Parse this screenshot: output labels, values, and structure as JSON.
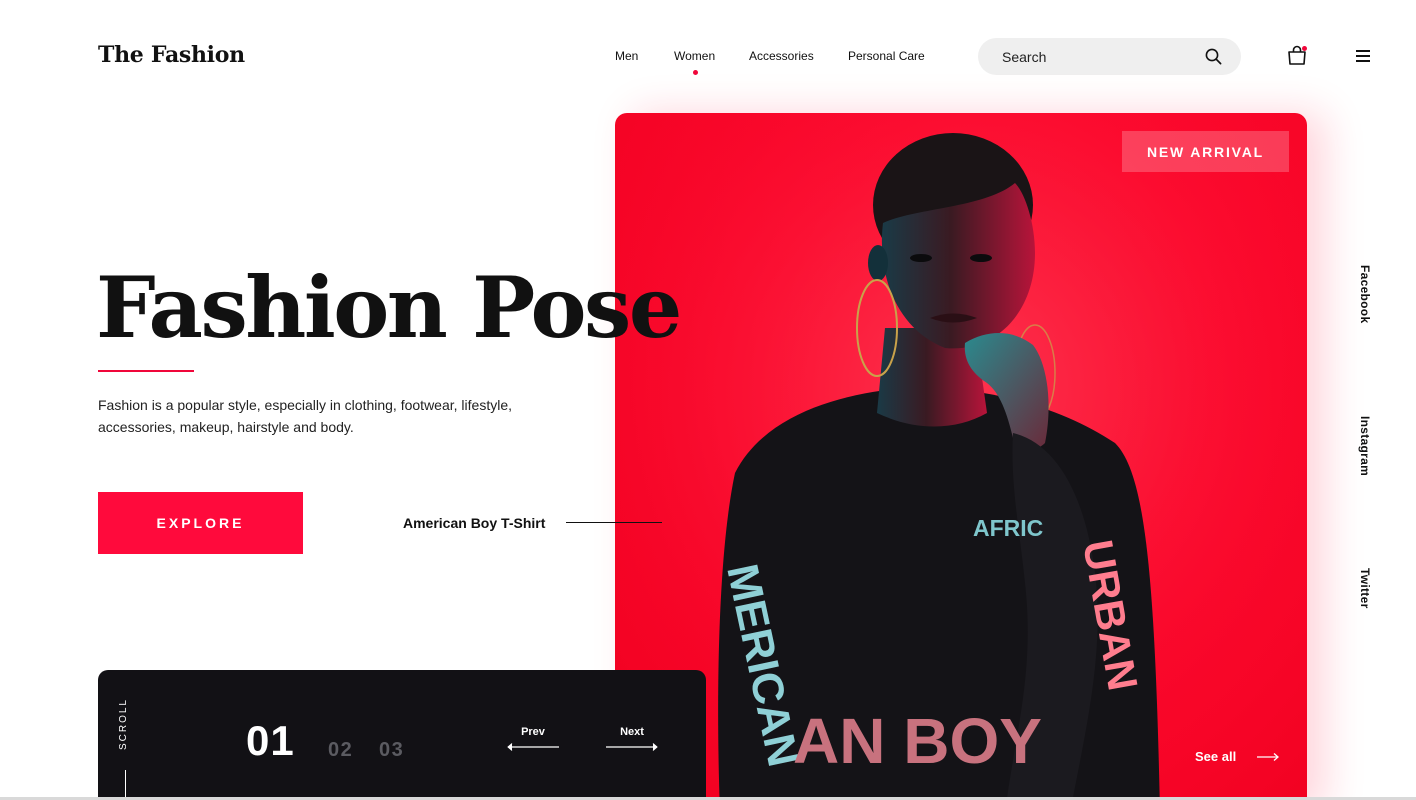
{
  "brand": {
    "logo": "The Fashion"
  },
  "nav": {
    "items": [
      {
        "label": "Men",
        "active": false
      },
      {
        "label": "Women",
        "active": true
      },
      {
        "label": "Accessories",
        "active": false
      },
      {
        "label": "Personal Care",
        "active": false
      }
    ]
  },
  "search": {
    "placeholder": "Search",
    "icon": "search-icon"
  },
  "header_icons": {
    "cart": "shopping-bag-icon",
    "menu": "hamburger-menu-icon"
  },
  "hero": {
    "title": "Fashion Pose",
    "description": "Fashion is a popular style, especially in clothing, footwear, lifestyle, accessories, makeup, hairstyle and body.",
    "cta_label": "EXPLORE",
    "product_label": "American Boy T-Shirt",
    "badge": "NEW ARRIVAL",
    "see_all": "See all",
    "shirt_text": {
      "chest": "AFRIC",
      "bottom": "AN BOY",
      "left_sleeve": "MERICAN",
      "right_sleeve": "URBAN"
    }
  },
  "social": [
    "Facebook",
    "Instagram",
    "Twitter"
  ],
  "slider": {
    "scroll_label": "SCROLL",
    "current": "01",
    "others": [
      "02",
      "03"
    ],
    "prev_label": "Prev",
    "next_label": "Next"
  },
  "colors": {
    "accent": "#f0063a",
    "hero_bg": "#ff0a2f",
    "panel_bg": "#121115"
  }
}
